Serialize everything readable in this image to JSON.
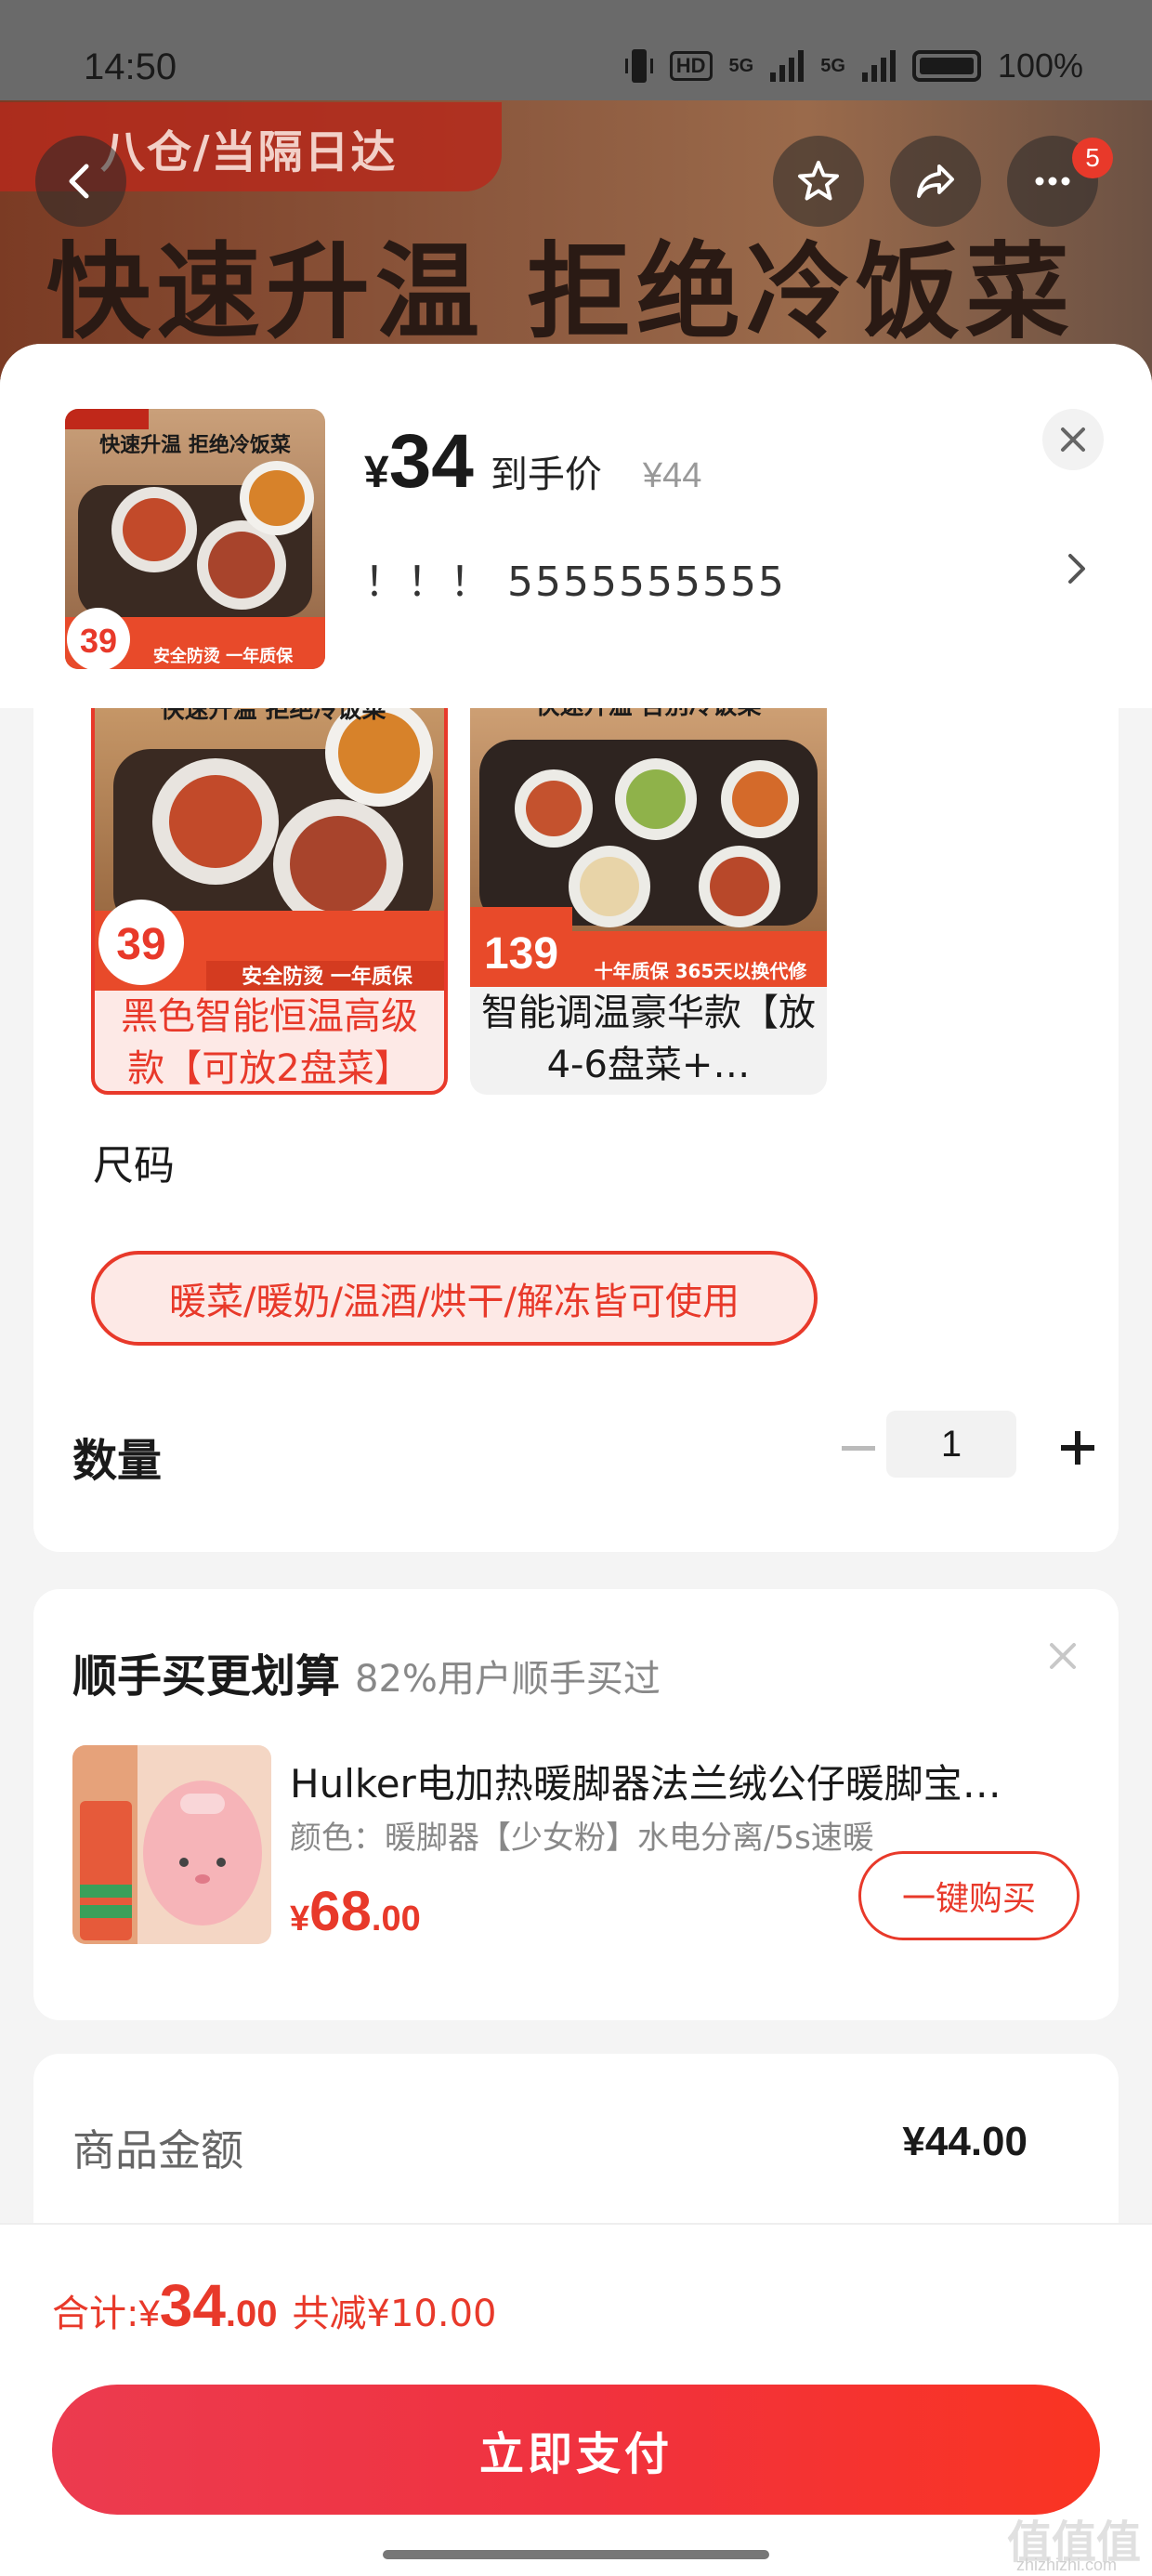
{
  "status_bar": {
    "time": "14:50",
    "hd_chip": "HD",
    "network_a": "5G",
    "network_b": "5G",
    "battery": "100%"
  },
  "background": {
    "logo_text": "八仓/当隔日达",
    "headline": "快速升温  拒绝冷饭菜",
    "cart_badge": "5"
  },
  "header": {
    "price_symbol": "¥",
    "price": "34",
    "price_label": "到手价",
    "original_price": "¥44",
    "selected_spec": "！！！  5555555555",
    "thumb_tag": "快速升温  拒绝冷饭菜",
    "thumb_price_tag": "39",
    "thumb_footer": "安全防烫  一年质保"
  },
  "variants": [
    {
      "label": "黑色智能恒温高级款【可放2盘菜】",
      "image_headline": "快速升温  拒绝冷饭菜",
      "image_price": "39",
      "image_footer": "安全防烫  一年质保",
      "selected": true
    },
    {
      "label": "智能调温豪华款【放4-6盘菜+…",
      "image_headline": "快速升温  告别冷饭菜",
      "image_price": "139",
      "image_footer": "十年质保  365天以换代修",
      "selected": false
    }
  ],
  "size": {
    "title": "尺码",
    "option": "暖菜/暖奶/温酒/烘干/解冻皆可使用"
  },
  "quantity": {
    "title": "数量",
    "value": "1"
  },
  "combo": {
    "title": "顺手买更划算",
    "subtitle": "82%用户顺手买过",
    "product_name": "Hulker电加热暖脚器法兰绒公仔暖脚宝…",
    "product_spec": "颜色：暖脚器【少女粉】水电分离/5s速暖",
    "price_symbol": "¥",
    "price_int": "68",
    "price_dec": ".00",
    "buy_label": "一键购买"
  },
  "amount": {
    "label": "商品金额",
    "value": "¥44.00"
  },
  "footer": {
    "total_label": "合计:",
    "total_symbol": "¥",
    "total_int": "34",
    "total_dec": ".00",
    "discount": "共减¥10.00",
    "pay_label": "立即支付",
    "watermark": "值值值",
    "watermark_sub": "zhizhizhi.com"
  },
  "colors": {
    "accent": "#e8392a",
    "pay_gradient_start": "#ec3b4f",
    "pay_gradient_end": "#fa3422"
  },
  "icons": [
    "back-icon",
    "star-icon",
    "share-icon",
    "more-icon",
    "close-icon",
    "chevron-right-icon",
    "minus-icon",
    "plus-icon"
  ]
}
